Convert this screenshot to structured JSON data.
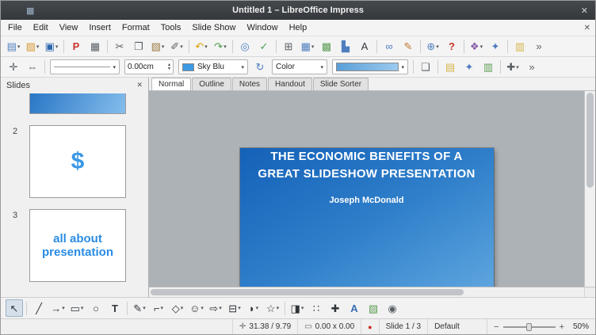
{
  "ui_glyphs": {
    "dropdown": "▾",
    "spin_up": "▴",
    "spin_down": "▾"
  },
  "titlebar": {
    "title": "Untitled 1 – LibreOffice Impress",
    "app_icon_glyph": "▦",
    "close_glyph": "✕"
  },
  "menubar": {
    "close_glyph": "✕",
    "items": [
      {
        "name": "menu-file",
        "label": "File"
      },
      {
        "name": "menu-edit",
        "label": "Edit"
      },
      {
        "name": "menu-view",
        "label": "View"
      },
      {
        "name": "menu-insert",
        "label": "Insert"
      },
      {
        "name": "menu-format",
        "label": "Format"
      },
      {
        "name": "menu-tools",
        "label": "Tools"
      },
      {
        "name": "menu-slide-show",
        "label": "Slide Show"
      },
      {
        "name": "menu-window",
        "label": "Window"
      },
      {
        "name": "menu-help",
        "label": "Help"
      }
    ]
  },
  "toolbar_standard": {
    "items": [
      {
        "name": "new-presentation-button",
        "glyph": "▤",
        "color": "#4f7ec0",
        "dropdown": true
      },
      {
        "name": "open-file-button",
        "glyph": "▨",
        "color": "#d99a33",
        "dropdown": true
      },
      {
        "name": "save-button",
        "glyph": "▣",
        "color": "#2e66ad",
        "dropdown": true
      },
      {
        "sep": true
      },
      {
        "name": "export-pdf-button",
        "glyph": "P",
        "color": "#c9342a",
        "bold": true
      },
      {
        "name": "print-button",
        "glyph": "▦",
        "color": "#5a6066"
      },
      {
        "sep": true
      },
      {
        "name": "cut-button",
        "glyph": "✂",
        "color": "#5a6066"
      },
      {
        "name": "copy-button",
        "glyph": "❐",
        "color": "#5a6066"
      },
      {
        "name": "paste-button",
        "glyph": "▧",
        "color": "#9a7b45",
        "dropdown": true
      },
      {
        "name": "clone-formatting-button",
        "glyph": "✐",
        "color": "#5a6066",
        "dropdown": true
      },
      {
        "sep": true
      },
      {
        "name": "undo-button",
        "glyph": "↶",
        "color": "#d9a000",
        "dropdown": true
      },
      {
        "name": "redo-button",
        "glyph": "↷",
        "color": "#4e9a4e",
        "dropdown": true
      },
      {
        "sep": true
      },
      {
        "name": "find-replace-button",
        "glyph": "◎",
        "color": "#4f7ec0"
      },
      {
        "name": "spelling-button",
        "glyph": "✓",
        "color": "#4e9a4e"
      },
      {
        "sep": true
      },
      {
        "name": "display-grid-button",
        "glyph": "⊞",
        "color": "#5a6066"
      },
      {
        "name": "insert-table-button",
        "glyph": "▦",
        "color": "#4f7ec0",
        "dropdown": true
      },
      {
        "name": "insert-image-button",
        "glyph": "▩",
        "color": "#5f9e57"
      },
      {
        "name": "insert-chart-button",
        "glyph": "▙",
        "color": "#4f7ec0"
      },
      {
        "name": "insert-text-box-button",
        "glyph": "A",
        "color": "#33383d"
      },
      {
        "sep": true
      },
      {
        "name": "insert-hyperlink-button",
        "glyph": "∞",
        "color": "#4f7ec0"
      },
      {
        "name": "show-draw-functions-button",
        "glyph": "✎",
        "color": "#c07830"
      },
      {
        "sep": true
      },
      {
        "name": "zoom-button",
        "glyph": "⊕",
        "color": "#4f7ec0",
        "dropdown": true
      },
      {
        "name": "help-button",
        "glyph": "?",
        "color": "#c9342a",
        "bold": true
      },
      {
        "sep": true
      },
      {
        "name": "gallery-button",
        "glyph": "❖",
        "color": "#8859a8",
        "dropdown": true
      },
      {
        "name": "navigator-button",
        "glyph": "✦",
        "color": "#4f7ec0"
      },
      {
        "sep": true
      },
      {
        "name": "comment-button",
        "glyph": "▥",
        "color": "#d8b54a"
      },
      {
        "name": "toolbar-overflow-button",
        "glyph": "»",
        "color": "#5a6066"
      }
    ]
  },
  "toolbar_line": {
    "items_left": [
      {
        "name": "edit-points-button",
        "glyph": "✛",
        "color": "#5a6066"
      },
      {
        "name": "line-arrow-style-button",
        "glyph": "⇔",
        "color": "#5a6066"
      },
      {
        "sep": true
      }
    ],
    "line_width_value": "0.00cm",
    "line_color_label": "Sky Blu",
    "area_style_label": "Color",
    "items_mid": [
      {
        "name": "rotate-button",
        "glyph": "↻",
        "color": "#4f7ec0"
      }
    ],
    "items_right": [
      {
        "sep": true
      },
      {
        "name": "shadow-button",
        "glyph": "❑",
        "color": "#5a6066"
      },
      {
        "sep": true
      },
      {
        "name": "slide-properties-button",
        "glyph": "▤",
        "color": "#d8b54a"
      },
      {
        "name": "interaction-button",
        "glyph": "✦",
        "color": "#4f7ec0"
      },
      {
        "name": "presentation-views-button",
        "glyph": "▥",
        "color": "#5f9e57"
      },
      {
        "sep": true
      },
      {
        "name": "glue-points-button",
        "glyph": "✚",
        "color": "#5a6066",
        "dropdown": true
      },
      {
        "name": "toolbar-overflow-button",
        "glyph": "»",
        "color": "#5a6066"
      }
    ]
  },
  "slides_panel": {
    "title": "Slides",
    "close_glyph": "✕",
    "slides": [
      {
        "type": "partial-gradient"
      },
      {
        "number": "2",
        "text": "$"
      },
      {
        "number": "3",
        "text": "all about\npresentation"
      }
    ]
  },
  "view_tabs": {
    "items": [
      {
        "name": "tab-normal",
        "label": "Normal",
        "active": true
      },
      {
        "name": "tab-outline",
        "label": "Outline"
      },
      {
        "name": "tab-notes",
        "label": "Notes"
      },
      {
        "name": "tab-handout",
        "label": "Handout"
      },
      {
        "name": "tab-slide-sorter",
        "label": "Slide Sorter"
      }
    ]
  },
  "slide": {
    "title": "THE ECONOMIC BENEFITS OF A\nGREAT SLIDESHOW PRESENTATION",
    "subtitle": "Joseph McDonald",
    "gradient_start": "#1461b8",
    "gradient_end": "#6fb3e6"
  },
  "drawing_toolbar": {
    "items": [
      {
        "name": "select-tool",
        "glyph": "↖",
        "color": "#2f343a",
        "active": true
      },
      {
        "sep": true
      },
      {
        "name": "line-tool",
        "glyph": "╱",
        "color": "#2f343a"
      },
      {
        "name": "line-arrow-tool",
        "glyph": "→",
        "color": "#2f343a",
        "dropdown": true
      },
      {
        "name": "rectangle-tool",
        "glyph": "▭",
        "color": "#2f343a",
        "dropdown": true
      },
      {
        "name": "ellipse-tool",
        "glyph": "○",
        "color": "#2f343a"
      },
      {
        "name": "text-box-tool",
        "glyph": "T",
        "color": "#2f343a",
        "bold": true
      },
      {
        "sep": true
      },
      {
        "name": "curve-tool",
        "glyph": "✎",
        "color": "#2f343a",
        "dropdown": true
      },
      {
        "name": "connector-tool",
        "glyph": "⌐",
        "color": "#2f343a",
        "dropdown": true
      },
      {
        "name": "basic-shapes-tool",
        "glyph": "◇",
        "color": "#2f343a",
        "dropdown": true
      },
      {
        "name": "symbol-shapes-tool",
        "glyph": "☺",
        "color": "#2f343a",
        "dropdown": true
      },
      {
        "name": "block-arrows-tool",
        "glyph": "⇨",
        "color": "#2f343a",
        "dropdown": true
      },
      {
        "name": "flowchart-tool",
        "glyph": "⊟",
        "color": "#2f343a",
        "dropdown": true
      },
      {
        "name": "callout-shapes-tool",
        "glyph": "◗",
        "color": "#2f343a",
        "dropdown": true
      },
      {
        "name": "stars-banners-tool",
        "glyph": "☆",
        "color": "#2f343a",
        "dropdown": true
      },
      {
        "sep": true
      },
      {
        "name": "3d-objects-tool",
        "glyph": "◨",
        "color": "#2f343a",
        "dropdown": true
      },
      {
        "name": "edit-points-tool",
        "glyph": "∷",
        "color": "#2f343a"
      },
      {
        "name": "glue-points-tool",
        "glyph": "✚",
        "color": "#2f343a"
      },
      {
        "name": "fontwork-tool",
        "glyph": "A",
        "color": "#3a6fb0",
        "bold": true
      },
      {
        "name": "insert-image-tool",
        "glyph": "▧",
        "color": "#5f9e57"
      },
      {
        "name": "toggle-extrusion-tool",
        "glyph": "◉",
        "color": "#5a6066"
      }
    ]
  },
  "statusbar": {
    "position": "31.38 / 9.79",
    "object_size": "0.00 x 0.00",
    "slide_info": "Slide 1 / 3",
    "page_style": "Default",
    "zoom": "50%",
    "icons": {
      "position": "✛",
      "size": "▭",
      "modified": "●",
      "zoom_out": "−",
      "zoom_in": "+"
    }
  }
}
